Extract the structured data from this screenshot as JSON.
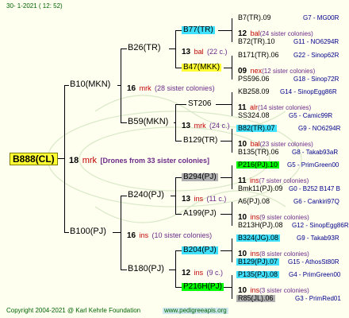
{
  "header": {
    "date": "30-   1-2021  ( 12:  52)"
  },
  "root": {
    "id": "B888(CL)",
    "count": "18",
    "type": "mrk",
    "note": "[Drones from 33 sister colonies]"
  },
  "nodes": {
    "b10": "B10(MKN)",
    "b100": "B100(PJ)",
    "b26": "B26(TR)",
    "b59": "B59(MKN)",
    "b240": "B240(PJ)",
    "b180": "B180(PJ)",
    "b77": "B77(TR)",
    "b47": "B47(MKK)",
    "st206": "ST206",
    "b129": "B129(TR)",
    "b294": "B294(PJ)",
    "a199": "A199(PJ)",
    "b204": "B204(PJ)",
    "p216": "P216H(PJ)"
  },
  "mid": {
    "b10": {
      "count": "16",
      "type": "mrk",
      "note": "(28 sister colonies)"
    },
    "b100": {
      "count": "16",
      "type": "ins",
      "note": "(10 sister colonies)"
    },
    "b26": {
      "count": "13",
      "type": "bal",
      "note": "(22 c.)"
    },
    "b59": {
      "count": "13",
      "type": "mrk",
      "note": "(24 c.)"
    },
    "b240": {
      "count": "13",
      "type": "ins",
      "note": "(11 c.)"
    },
    "b180": {
      "count": "12",
      "type": "ins",
      "note": "(9 c.)"
    }
  },
  "leaves": [
    {
      "id": "B7(TR).09",
      "ref": "G7 - MG00R"
    },
    {
      "count": "12",
      "type": "bal",
      "note": "(24 sister colonies)"
    },
    {
      "id": "B72(TR).10",
      "ref": "G11 - NO6294R"
    },
    {
      "id": "B171(TR).06",
      "ref": "G22 - Sinop62R"
    },
    {
      "count": "09",
      "type": "nex",
      "note": "(12 sister colonies)"
    },
    {
      "id": "PS596.06",
      "ref": "G18 - Sinop72R"
    },
    {
      "id": "KB258.09",
      "ref": "G14 - SinopEgg86R"
    },
    {
      "count": "11",
      "type": "alr",
      "note": "(14 sister colonies)"
    },
    {
      "id": "SS324.08",
      "ref": "G5 - Camic99R"
    },
    {
      "id": "B82(TR).07",
      "ref": "G9 - NO6294R"
    },
    {
      "count": "10",
      "type": "bal",
      "note": "(23 sister colonies)"
    },
    {
      "id": "B135(TR).06",
      "ref": "G8 - Takab93aR"
    },
    {
      "id": "P216(PJ).10",
      "ref": "G5 - PrimGreen00"
    },
    {
      "count": "11",
      "type": "ins",
      "note": "(7 sister colonies)"
    },
    {
      "id": "Bmk11(PJ).09",
      "ref": "G0 - B252 B147 B"
    },
    {
      "id": "A6(PJ).08",
      "ref": "G6 - Cankiri97Q"
    },
    {
      "count": "10",
      "type": "ins",
      "note": "(9 sister colonies)"
    },
    {
      "id": "B213H(PJ).08",
      "ref": "G12 - SinopEgg86R"
    },
    {
      "id": "B324(JG).08",
      "ref": "G9 - Takab93R"
    },
    {
      "count": "10",
      "type": "ins",
      "note": "(8 sister colonies)"
    },
    {
      "id": "B129(PJ).07",
      "ref": "G15 - AthosSt80R"
    },
    {
      "id": "P135(PJ).08",
      "ref": "G4 - PrimGreen00"
    },
    {
      "count": "10",
      "type": "ins",
      "note": "(3 sister colonies)"
    },
    {
      "id": "R85(JL).06",
      "ref": "G3 - PrimRed01"
    }
  ],
  "footer": {
    "copyright": "Copyright 2004-2021 @ Karl Kehrle Foundation",
    "site": "www.pedigreeapis.org"
  }
}
